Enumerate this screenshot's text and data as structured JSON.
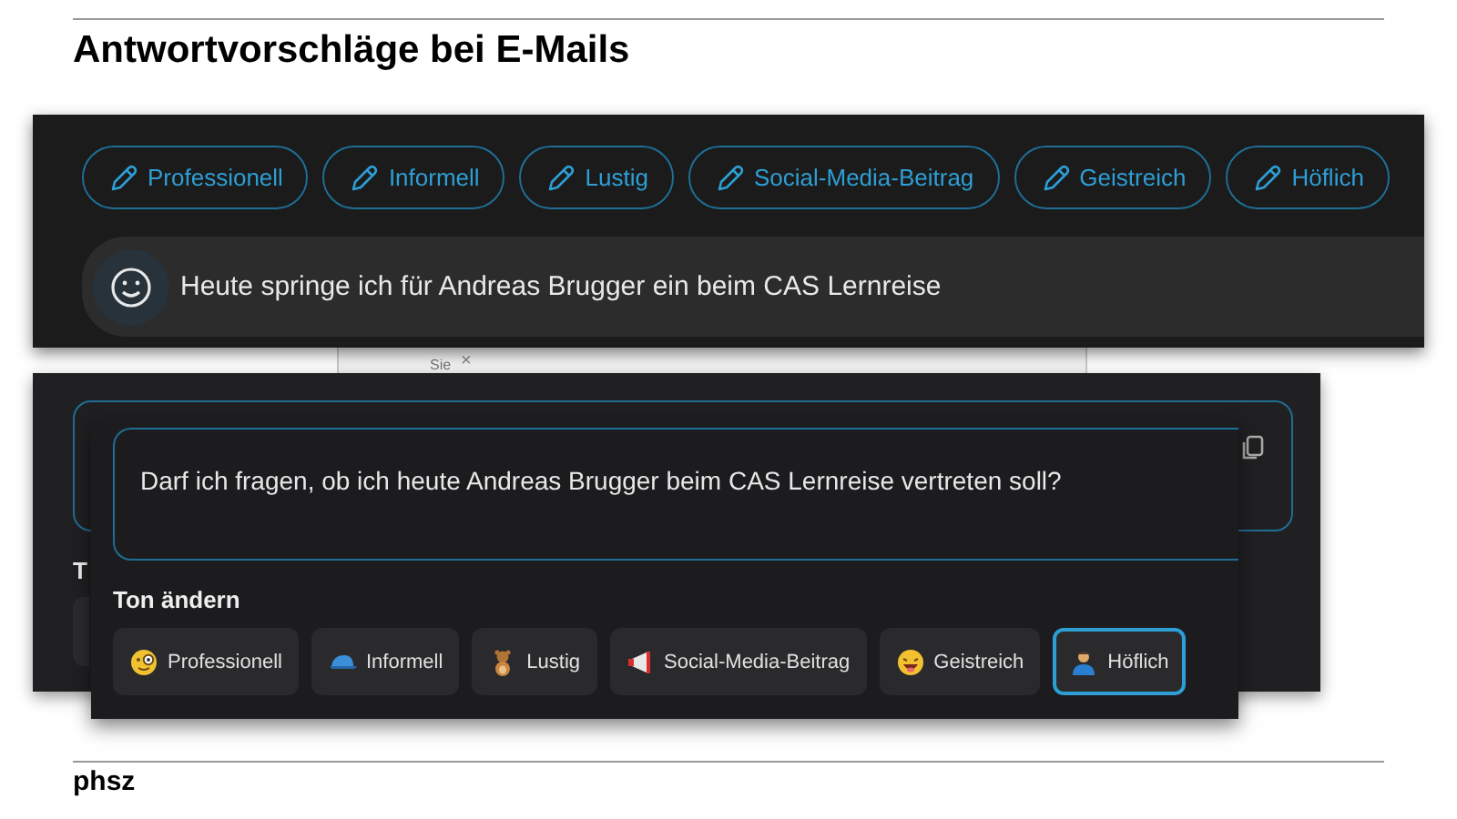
{
  "slide": {
    "title": "Antwortvorschläge bei E-Mails",
    "footer": "phsz"
  },
  "suggestion_bar": {
    "chips": [
      {
        "label": "Professionell"
      },
      {
        "label": "Informell"
      },
      {
        "label": "Lustig"
      },
      {
        "label": "Social-Media-Beitrag"
      },
      {
        "label": "Geistreich"
      },
      {
        "label": "Höflich"
      }
    ],
    "input": {
      "value": "Heute springe ich für Andreas Brugger ein beim CAS Lernreise"
    }
  },
  "background_window": {
    "caption": "Sie",
    "close": "×"
  },
  "back_panel": {
    "heading": "T"
  },
  "tone_panel": {
    "reply": "Darf ich fragen, ob ich heute Andreas Brugger beim CAS Lernreise vertreten soll?",
    "heading": "Ton ändern",
    "tones": [
      {
        "label": "Professionell",
        "selected": false
      },
      {
        "label": "Informell",
        "selected": false
      },
      {
        "label": "Lustig",
        "selected": false
      },
      {
        "label": "Social-Media-Beitrag",
        "selected": false
      },
      {
        "label": "Geistreich",
        "selected": false
      },
      {
        "label": "Höflich",
        "selected": true
      }
    ]
  }
}
